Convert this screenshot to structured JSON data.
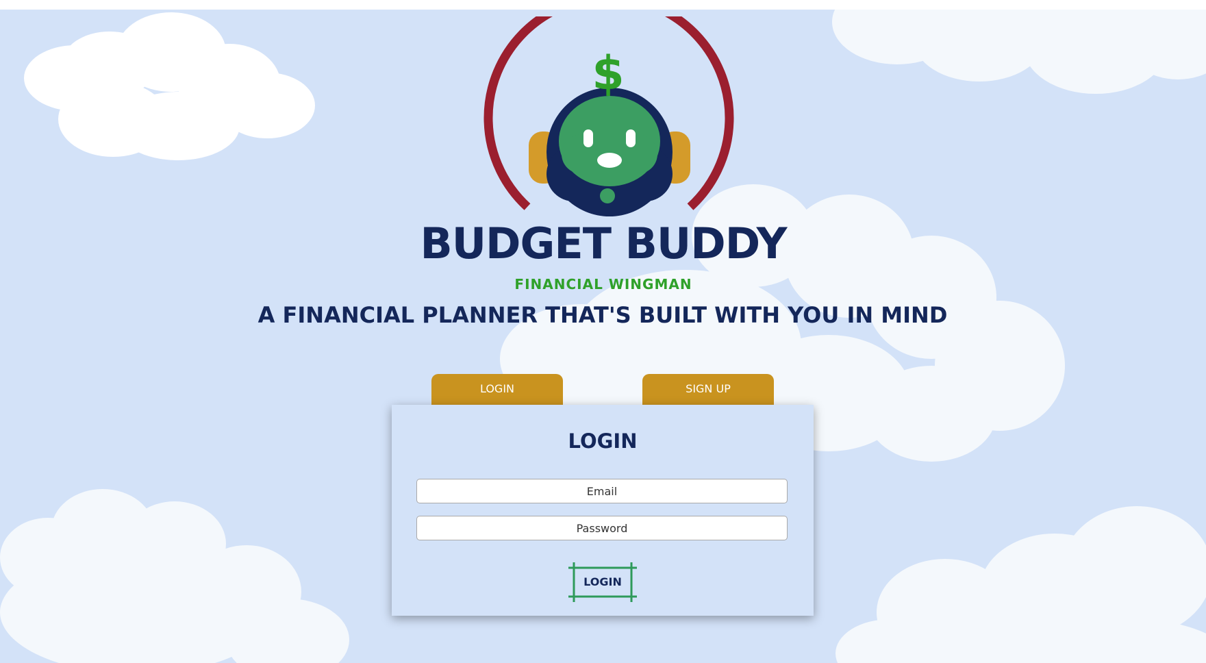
{
  "brand": {
    "name": "BUDGET BUDDY",
    "subtitle": "FINANCIAL WINGMAN",
    "logo_icon": "robot-dollar-logo",
    "colors": {
      "navy": "#14275a",
      "green": "#2fa12a",
      "robot_face": "#3c9e62",
      "arc": "#9b1f2f",
      "ear": "#d49b2a"
    }
  },
  "tagline": "A FINANCIAL PLANNER THAT'S BUILT WITH YOU IN MIND",
  "tabs": [
    {
      "label": "LOGIN"
    },
    {
      "label": "SIGN UP"
    }
  ],
  "tab_color": "#c9931f",
  "form": {
    "title": "LOGIN",
    "email_placeholder": "Email",
    "password_placeholder": "Password",
    "submit_label": "LOGIN"
  },
  "background_color": "#d3e2f8"
}
